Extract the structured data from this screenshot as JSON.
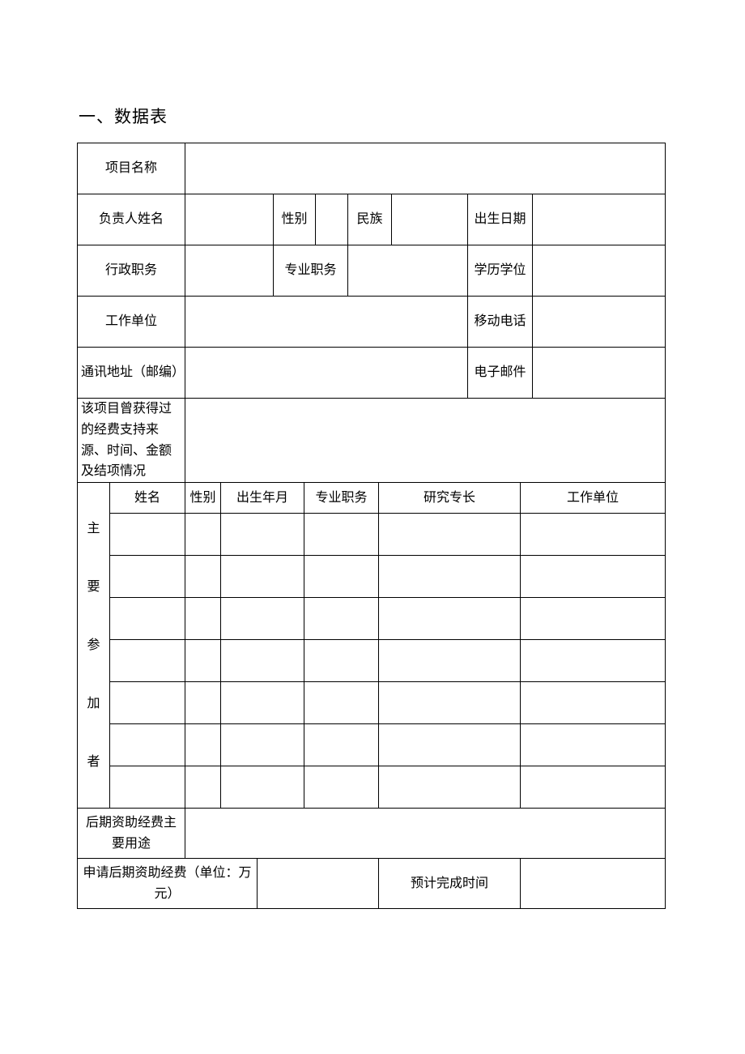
{
  "section_title": "一、数据表",
  "labels": {
    "project_name": "项目名称",
    "leader_name": "负责人姓名",
    "gender": "性别",
    "ethnicity": "民族",
    "birth_date": "出生日期",
    "admin_position": "行政职务",
    "professional_title": "专业职务",
    "degree": "学历学位",
    "work_unit": "工作单位",
    "mobile": "移动电话",
    "address": "通讯地址（邮编）",
    "email": "电子邮件",
    "prior_funding": "该项目曾获得过的经费支持来源、时间、金额及结项情况",
    "participants_vertical": "主要参加者",
    "p_name": "姓名",
    "p_gender": "性别",
    "p_birth": "出生年月",
    "p_title": "专业职务",
    "p_specialty": "研究专长",
    "p_workunit": "工作单位",
    "fund_usage": "后期资助经费主要用途",
    "apply_amount": "申请后期资助经费（单位：万元）",
    "expected_completion": "预计完成时间"
  },
  "values": {
    "project_name": "",
    "leader_name": "",
    "gender": "",
    "ethnicity": "",
    "birth_date": "",
    "admin_position": "",
    "professional_title": "",
    "degree": "",
    "work_unit": "",
    "mobile": "",
    "address": "",
    "email": "",
    "prior_funding": "",
    "fund_usage": "",
    "apply_amount": "",
    "expected_completion": ""
  },
  "participants": [
    {
      "name": "",
      "gender": "",
      "birth": "",
      "title": "",
      "specialty": "",
      "workunit": ""
    },
    {
      "name": "",
      "gender": "",
      "birth": "",
      "title": "",
      "specialty": "",
      "workunit": ""
    },
    {
      "name": "",
      "gender": "",
      "birth": "",
      "title": "",
      "specialty": "",
      "workunit": ""
    },
    {
      "name": "",
      "gender": "",
      "birth": "",
      "title": "",
      "specialty": "",
      "workunit": ""
    },
    {
      "name": "",
      "gender": "",
      "birth": "",
      "title": "",
      "specialty": "",
      "workunit": ""
    },
    {
      "name": "",
      "gender": "",
      "birth": "",
      "title": "",
      "specialty": "",
      "workunit": ""
    },
    {
      "name": "",
      "gender": "",
      "birth": "",
      "title": "",
      "specialty": "",
      "workunit": ""
    }
  ]
}
